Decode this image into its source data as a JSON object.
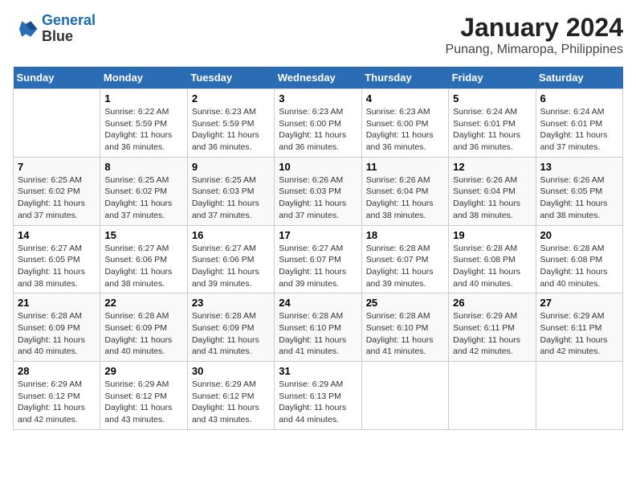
{
  "header": {
    "logo_line1": "General",
    "logo_line2": "Blue",
    "title": "January 2024",
    "subtitle": "Punang, Mimaropa, Philippines"
  },
  "weekdays": [
    "Sunday",
    "Monday",
    "Tuesday",
    "Wednesday",
    "Thursday",
    "Friday",
    "Saturday"
  ],
  "weeks": [
    [
      {
        "day": "",
        "info": ""
      },
      {
        "day": "1",
        "info": "Sunrise: 6:22 AM\nSunset: 5:59 PM\nDaylight: 11 hours\nand 36 minutes."
      },
      {
        "day": "2",
        "info": "Sunrise: 6:23 AM\nSunset: 5:59 PM\nDaylight: 11 hours\nand 36 minutes."
      },
      {
        "day": "3",
        "info": "Sunrise: 6:23 AM\nSunset: 6:00 PM\nDaylight: 11 hours\nand 36 minutes."
      },
      {
        "day": "4",
        "info": "Sunrise: 6:23 AM\nSunset: 6:00 PM\nDaylight: 11 hours\nand 36 minutes."
      },
      {
        "day": "5",
        "info": "Sunrise: 6:24 AM\nSunset: 6:01 PM\nDaylight: 11 hours\nand 36 minutes."
      },
      {
        "day": "6",
        "info": "Sunrise: 6:24 AM\nSunset: 6:01 PM\nDaylight: 11 hours\nand 37 minutes."
      }
    ],
    [
      {
        "day": "7",
        "info": "Sunrise: 6:25 AM\nSunset: 6:02 PM\nDaylight: 11 hours\nand 37 minutes."
      },
      {
        "day": "8",
        "info": "Sunrise: 6:25 AM\nSunset: 6:02 PM\nDaylight: 11 hours\nand 37 minutes."
      },
      {
        "day": "9",
        "info": "Sunrise: 6:25 AM\nSunset: 6:03 PM\nDaylight: 11 hours\nand 37 minutes."
      },
      {
        "day": "10",
        "info": "Sunrise: 6:26 AM\nSunset: 6:03 PM\nDaylight: 11 hours\nand 37 minutes."
      },
      {
        "day": "11",
        "info": "Sunrise: 6:26 AM\nSunset: 6:04 PM\nDaylight: 11 hours\nand 38 minutes."
      },
      {
        "day": "12",
        "info": "Sunrise: 6:26 AM\nSunset: 6:04 PM\nDaylight: 11 hours\nand 38 minutes."
      },
      {
        "day": "13",
        "info": "Sunrise: 6:26 AM\nSunset: 6:05 PM\nDaylight: 11 hours\nand 38 minutes."
      }
    ],
    [
      {
        "day": "14",
        "info": "Sunrise: 6:27 AM\nSunset: 6:05 PM\nDaylight: 11 hours\nand 38 minutes."
      },
      {
        "day": "15",
        "info": "Sunrise: 6:27 AM\nSunset: 6:06 PM\nDaylight: 11 hours\nand 38 minutes."
      },
      {
        "day": "16",
        "info": "Sunrise: 6:27 AM\nSunset: 6:06 PM\nDaylight: 11 hours\nand 39 minutes."
      },
      {
        "day": "17",
        "info": "Sunrise: 6:27 AM\nSunset: 6:07 PM\nDaylight: 11 hours\nand 39 minutes."
      },
      {
        "day": "18",
        "info": "Sunrise: 6:28 AM\nSunset: 6:07 PM\nDaylight: 11 hours\nand 39 minutes."
      },
      {
        "day": "19",
        "info": "Sunrise: 6:28 AM\nSunset: 6:08 PM\nDaylight: 11 hours\nand 40 minutes."
      },
      {
        "day": "20",
        "info": "Sunrise: 6:28 AM\nSunset: 6:08 PM\nDaylight: 11 hours\nand 40 minutes."
      }
    ],
    [
      {
        "day": "21",
        "info": "Sunrise: 6:28 AM\nSunset: 6:09 PM\nDaylight: 11 hours\nand 40 minutes."
      },
      {
        "day": "22",
        "info": "Sunrise: 6:28 AM\nSunset: 6:09 PM\nDaylight: 11 hours\nand 40 minutes."
      },
      {
        "day": "23",
        "info": "Sunrise: 6:28 AM\nSunset: 6:09 PM\nDaylight: 11 hours\nand 41 minutes."
      },
      {
        "day": "24",
        "info": "Sunrise: 6:28 AM\nSunset: 6:10 PM\nDaylight: 11 hours\nand 41 minutes."
      },
      {
        "day": "25",
        "info": "Sunrise: 6:28 AM\nSunset: 6:10 PM\nDaylight: 11 hours\nand 41 minutes."
      },
      {
        "day": "26",
        "info": "Sunrise: 6:29 AM\nSunset: 6:11 PM\nDaylight: 11 hours\nand 42 minutes."
      },
      {
        "day": "27",
        "info": "Sunrise: 6:29 AM\nSunset: 6:11 PM\nDaylight: 11 hours\nand 42 minutes."
      }
    ],
    [
      {
        "day": "28",
        "info": "Sunrise: 6:29 AM\nSunset: 6:12 PM\nDaylight: 11 hours\nand 42 minutes."
      },
      {
        "day": "29",
        "info": "Sunrise: 6:29 AM\nSunset: 6:12 PM\nDaylight: 11 hours\nand 43 minutes."
      },
      {
        "day": "30",
        "info": "Sunrise: 6:29 AM\nSunset: 6:12 PM\nDaylight: 11 hours\nand 43 minutes."
      },
      {
        "day": "31",
        "info": "Sunrise: 6:29 AM\nSunset: 6:13 PM\nDaylight: 11 hours\nand 44 minutes."
      },
      {
        "day": "",
        "info": ""
      },
      {
        "day": "",
        "info": ""
      },
      {
        "day": "",
        "info": ""
      }
    ]
  ]
}
